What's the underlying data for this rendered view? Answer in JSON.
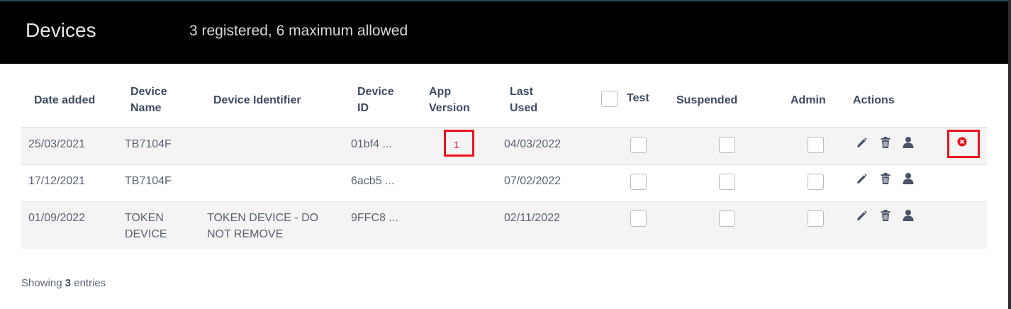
{
  "header": {
    "title": "Devices",
    "subtitle": "3 registered, 6 maximum allowed"
  },
  "table": {
    "columns": {
      "date_added": "Date added",
      "device_name_1": "Device",
      "device_name_2": "Name",
      "device_identifier": "Device Identifier",
      "device_id_1": "Device",
      "device_id_2": "ID",
      "app_version_1": "App",
      "app_version_2": "Version",
      "last_used_1": "Last",
      "last_used_2": "Used",
      "test": "Test",
      "suspended": "Suspended",
      "admin": "Admin",
      "actions": "Actions"
    },
    "rows": [
      {
        "date_added": "25/03/2021",
        "device_name_1": "TB7104F",
        "device_name_2": "",
        "device_identifier_1": "",
        "device_identifier_2": "",
        "device_id": "01bf4 ...",
        "app_version": "1",
        "last_used": "04/03/2022"
      },
      {
        "date_added": "17/12/2021",
        "device_name_1": "TB7104F",
        "device_name_2": "",
        "device_identifier_1": "",
        "device_identifier_2": "",
        "device_id": "6acb5 ...",
        "app_version": "",
        "last_used": "07/02/2022"
      },
      {
        "date_added": "01/09/2022",
        "device_name_1": "TOKEN",
        "device_name_2": "DEVICE",
        "device_identifier_1": "TOKEN DEVICE - DO",
        "device_identifier_2": "NOT REMOVE",
        "device_id": "9FFC8 ...",
        "app_version": "",
        "last_used": "02/11/2022"
      }
    ]
  },
  "footer": {
    "prefix": "Showing",
    "count": "3",
    "suffix": "entries"
  },
  "icons": {
    "edit": "pencil-icon",
    "delete": "trash-icon",
    "user": "user-icon",
    "remove": "close-circle-icon"
  },
  "colors": {
    "header_bg": "#000000",
    "highlight": "#e8141c",
    "icon": "#4a5467"
  }
}
